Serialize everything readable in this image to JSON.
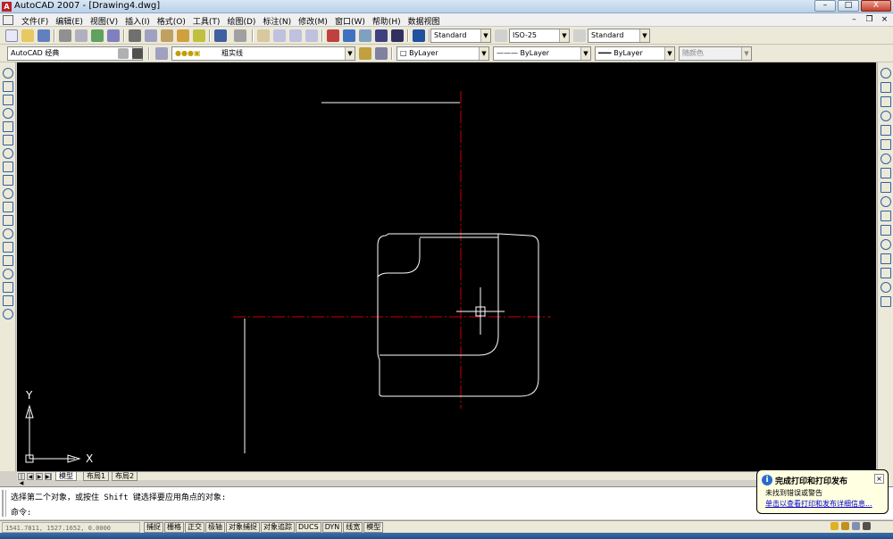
{
  "window": {
    "title": "AutoCAD 2007 - [Drawing4.dwg]",
    "min": "–",
    "max": "□",
    "close": "X"
  },
  "menu": [
    "文件(F)",
    "编辑(E)",
    "视图(V)",
    "插入(I)",
    "格式(O)",
    "工具(T)",
    "绘图(D)",
    "标注(N)",
    "修改(M)",
    "窗口(W)",
    "帮助(H)",
    "数据视图"
  ],
  "doc_controls": {
    "min": "–",
    "restore": "❐",
    "close": "×"
  },
  "toolbar1": {
    "text_style": "Standard",
    "dim_style": "ISO-25",
    "table_style": "Standard"
  },
  "toolbar2": {
    "workspace": "AutoCAD 经典",
    "layer": "粗实线",
    "color": "ByLayer",
    "linetype": "ByLayer",
    "lineweight": "ByLayer",
    "plotstyle": "随颜色"
  },
  "axes": {
    "x": "X",
    "y": "Y"
  },
  "layout_tabs": [
    "模型",
    "布局1",
    "布局2"
  ],
  "command": {
    "history": "选择第二个对象，或按住 Shift 键选择要应用角点的对象:",
    "prompt": "命令:"
  },
  "status": {
    "coords": "1541.7811, 1527.1652, 0.0000",
    "buttons": [
      "捕捉",
      "栅格",
      "正交",
      "极轴",
      "对象捕捉",
      "对象追踪",
      "DUCS",
      "DYN",
      "线宽",
      "模型"
    ]
  },
  "balloon": {
    "title": "完成打印和打印发布",
    "text": "未找到错误或警告",
    "link": "单击以查看打印和发布详细信息..."
  },
  "colors": {
    "canvas": "#000000",
    "geometry": "#ffffff",
    "centerline": "#cc0000"
  },
  "left_tools": [
    "line-icon",
    "construction-line-icon",
    "polyline-icon",
    "polygon-icon",
    "rectangle-icon",
    "arc-icon",
    "circle-icon",
    "revision-cloud-icon",
    "spline-icon",
    "ellipse-icon",
    "ellipse-arc-icon",
    "insert-block-icon",
    "make-block-icon",
    "point-icon",
    "hatch-icon",
    "gradient-icon",
    "region-icon",
    "table-icon",
    "multiline-text-icon"
  ],
  "right_tools": [
    "erase-icon",
    "copy-icon",
    "mirror-icon",
    "offset-icon",
    "array-icon",
    "move-icon",
    "rotate-icon",
    "scale-icon",
    "stretch-icon",
    "trim-icon",
    "extend-icon",
    "break-at-point-icon",
    "break-icon",
    "join-icon",
    "chamfer-icon",
    "fillet-icon",
    "explode-icon"
  ]
}
